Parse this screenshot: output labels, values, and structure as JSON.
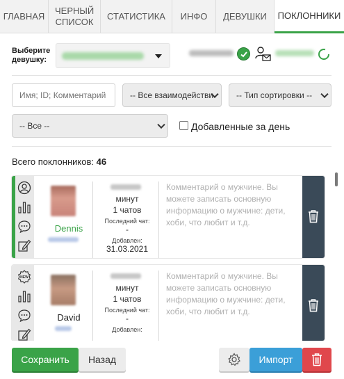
{
  "tabs": [
    {
      "label": "ГЛАВНАЯ",
      "active": false
    },
    {
      "label": "ЧЕРНЫЙ СПИСОК",
      "active": false
    },
    {
      "label": "СТАТИСТИКА",
      "active": false
    },
    {
      "label": "ИНФО",
      "active": false
    },
    {
      "label": "ДЕВУШКИ",
      "active": false
    },
    {
      "label": "ПОКЛОННИКИ",
      "active": true
    }
  ],
  "girl_select": {
    "label": "Выберите девушку:"
  },
  "filters": {
    "search_placeholder": "Имя; ID; Комментарий",
    "interaction_selected": "-- Все взаимодействия --",
    "sort_selected": "-- Тип сортировки --",
    "all_selected": "-- Все --",
    "added_today_label": "Добавленные за день",
    "added_today_checked": false
  },
  "total": {
    "label": "Всего поклонников:",
    "count": "46"
  },
  "fans": [
    {
      "name": "Dennis",
      "name_color": "#3aa348",
      "stripe_color": "#3aa348",
      "minutes_label": "минут",
      "chats": "1 чатов",
      "last_chat_label": "Последний чат:",
      "last_chat_value": "-",
      "added_label": "Добавлен:",
      "added_date": "31.03.2021",
      "comment_placeholder": "Комментарий о мужчине. Вы можете записать основную информацию о мужчине: дети, хоби, что любит и т.д.",
      "first_icon": "user-icon"
    },
    {
      "name": "David",
      "name_color": "#222222",
      "stripe_color": "#e8e8e8",
      "minutes_label": "минут",
      "chats": "1 чатов",
      "last_chat_label": "Последний чат:",
      "last_chat_value": "-",
      "added_label": "Добавлен:",
      "added_date": "",
      "comment_placeholder": "Комментарий о мужчине. Вы можете записать основную информацию о мужчине: дети, хоби, что любит и т.д.",
      "first_icon": "new-badge-icon"
    }
  ],
  "buttons": {
    "save": "Сохранить",
    "back": "Назад",
    "settings_icon": "gear-icon",
    "import": "Импорт",
    "delete_icon": "trash-icon"
  },
  "colors": {
    "accent_green": "#3aa348",
    "import_blue": "#3b9fd8",
    "danger_red": "#e0474c",
    "delete_panel": "#3a4a58"
  }
}
